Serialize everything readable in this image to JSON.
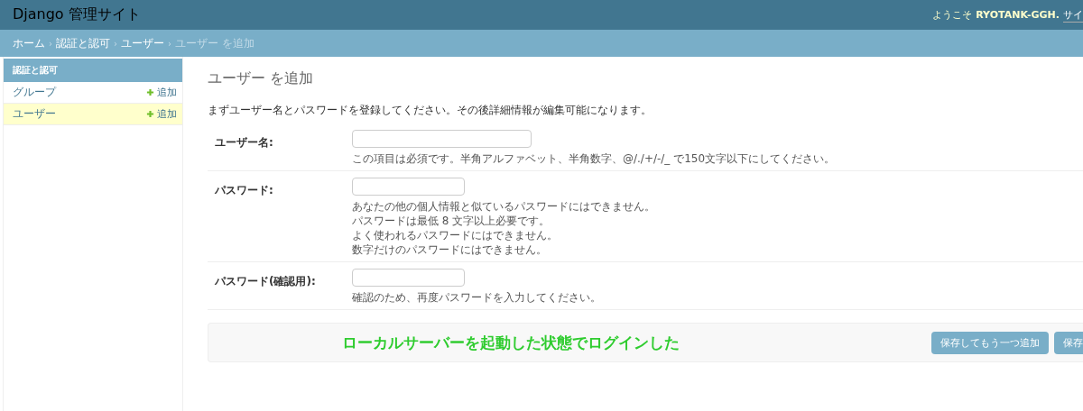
{
  "header": {
    "title": "Django 管理サイト",
    "welcome": "ようこそ",
    "user": "RYOTANK-GGH.",
    "link": "サイ"
  },
  "breadcrumb_separator": "›",
  "breadcrumbs": [
    {
      "label": "ホーム",
      "link": true
    },
    {
      "label": "認証と認可",
      "link": true
    },
    {
      "label": "ユーザー",
      "link": true
    },
    {
      "label": "ユーザー を追加",
      "link": false
    }
  ],
  "sidebar": {
    "caption": "認証と認可",
    "items": [
      {
        "label": "グループ",
        "add": "追加",
        "selected": false
      },
      {
        "label": "ユーザー",
        "add": "追加",
        "selected": true
      }
    ]
  },
  "page_title": "ユーザー を追加",
  "intro": "まずユーザー名とパスワードを登録してください。その後詳細情報が編集可能になります。",
  "fields": [
    {
      "label": "ユーザー名:",
      "kind": "wide",
      "help": [
        "この項目は必須です。半角アルファベット、半角数字、@/./+/-/_ で150文字以下にしてください。"
      ]
    },
    {
      "label": "パスワード:",
      "kind": "narrow",
      "help": [
        "あなたの他の個人情報と似ているパスワードにはできません。",
        "パスワードは最低 8 文字以上必要です。",
        "よく使われるパスワードにはできません。",
        "数字だけのパスワードにはできません。"
      ]
    },
    {
      "label": "パスワード(確認用):",
      "kind": "narrow",
      "help": [
        "確認のため、再度パスワードを入力してください。"
      ]
    }
  ],
  "annotation": "ローカルサーバーを起動した状態でログインした",
  "buttons": [
    "保存してもう一つ追加",
    "保存"
  ]
}
